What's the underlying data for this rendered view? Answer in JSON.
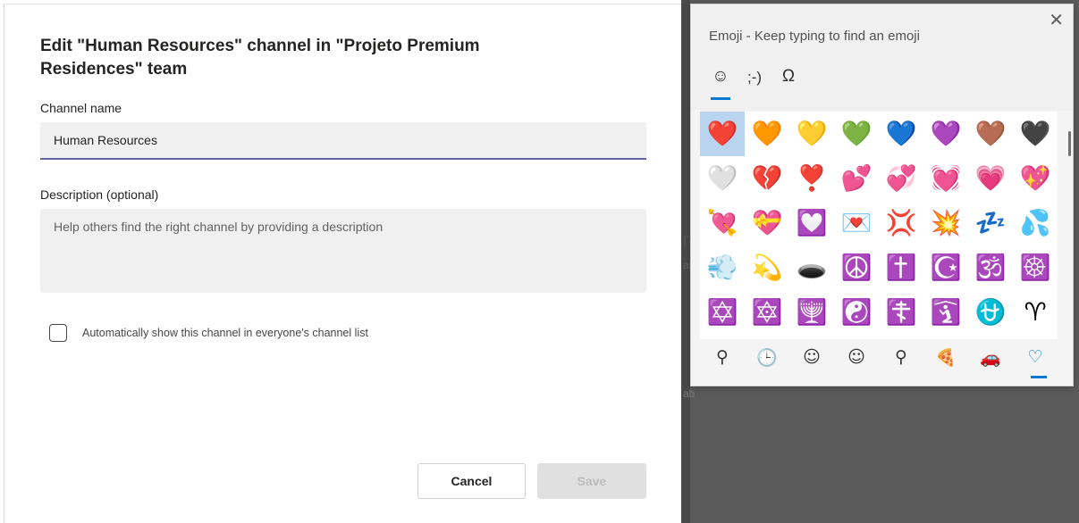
{
  "dialog": {
    "title": "Edit \"Human Resources\" channel in \"Projeto Premium Residences\" team",
    "channel_name_label": "Channel name",
    "channel_name_value": "Human Resources",
    "description_label": "Description (optional)",
    "description_placeholder": "Help others find the right channel by providing a description",
    "auto_show_label": "Automatically show this channel in everyone's channel list",
    "auto_show_checked": false,
    "cancel_label": "Cancel",
    "save_label": "Save"
  },
  "background": {
    "fragments": [
      "r",
      "ai",
      "ab"
    ]
  },
  "emoji_panel": {
    "title": "Emoji - Keep typing to find an emoji",
    "close_glyph": "✕",
    "tabs": [
      {
        "label": "☺",
        "name": "emoji-tab",
        "active": true
      },
      {
        "label": ";-)",
        "name": "kaomoji-tab",
        "active": false
      },
      {
        "label": "Ω",
        "name": "symbols-tab",
        "active": false
      }
    ],
    "emojis": [
      [
        "❤️",
        "🧡",
        "💛",
        "💚",
        "💙",
        "💜",
        "🤎",
        "🖤"
      ],
      [
        "🤍",
        "💔",
        "❣️",
        "💕",
        "💞",
        "💓",
        "💗",
        "💖"
      ],
      [
        "💘",
        "💝",
        "💟",
        "💌",
        "💢",
        "💥",
        "💤",
        "💦"
      ],
      [
        "💨",
        "💫",
        "🕳️",
        "☮️",
        "✝️",
        "☪️",
        "🕉️",
        "☸️"
      ],
      [
        "✡️",
        "🔯",
        "🕎",
        "☯️",
        "☦️",
        "🛐",
        "⛎",
        "♈"
      ]
    ],
    "categories": [
      {
        "label": "⚲",
        "name": "search-category-icon"
      },
      {
        "label": "🕒",
        "name": "recent-category-icon"
      },
      {
        "label": "☺",
        "name": "smileys-category-icon"
      },
      {
        "label": "☺",
        "name": "people-category-icon"
      },
      {
        "label": "⚲",
        "name": "places-category-icon"
      },
      {
        "label": "🍕",
        "name": "food-category-icon"
      },
      {
        "label": "🚗",
        "name": "transport-category-icon"
      },
      {
        "label": "♡",
        "name": "hearts-category-icon"
      }
    ],
    "active_category": 7,
    "selected_emoji": 0
  },
  "colors": {
    "accent": "#6264a7",
    "selection": "#b8d4ee",
    "tab_indicator": "#0078d4"
  }
}
